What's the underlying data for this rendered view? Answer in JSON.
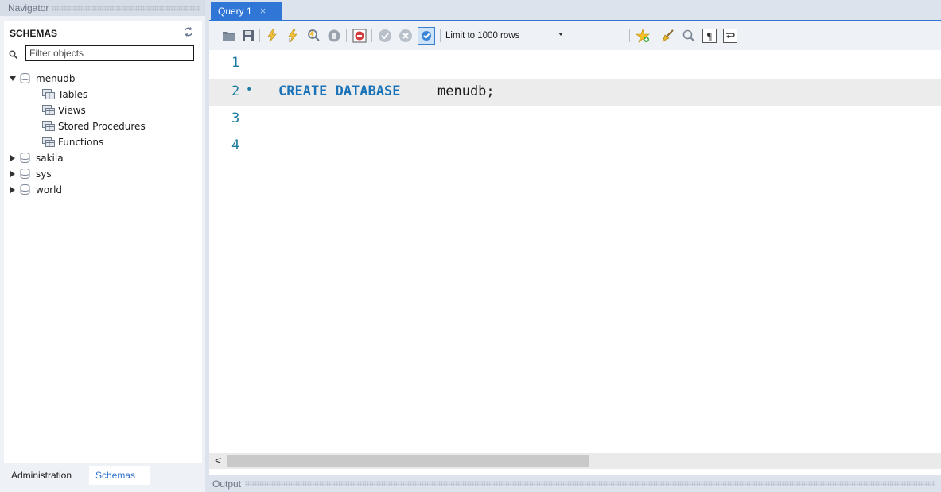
{
  "navigator": {
    "title": "Navigator",
    "schemas_heading": "SCHEMAS",
    "filter_placeholder": "Filter objects",
    "tree": [
      {
        "label": "menudb",
        "expanded": true,
        "children": [
          "Tables",
          "Views",
          "Stored Procedures",
          "Functions"
        ]
      },
      {
        "label": "sakila",
        "expanded": false
      },
      {
        "label": "sys",
        "expanded": false
      },
      {
        "label": "world",
        "expanded": false
      }
    ],
    "bottom_tabs": [
      "Administration",
      "Schemas"
    ],
    "active_bottom_tab": "Schemas"
  },
  "editor": {
    "tab_label": "Query 1",
    "tab_close": "×",
    "limit_label": "Limit to 1000 rows",
    "lines": [
      {
        "number": "1",
        "keyword": "",
        "text": ""
      },
      {
        "number": "2",
        "keyword": "CREATE DATABASE",
        "text": "menudb;",
        "bullet": "•"
      },
      {
        "number": "3",
        "keyword": "",
        "text": ""
      },
      {
        "number": "4",
        "keyword": "",
        "text": ""
      }
    ],
    "scroll_left": "<"
  },
  "output": {
    "label": "Output"
  },
  "colors": {
    "accent": "#2f76d6",
    "keyword": "#1a73b8",
    "line_number": "#1e7ba3",
    "active_link": "#2f6fd0"
  }
}
